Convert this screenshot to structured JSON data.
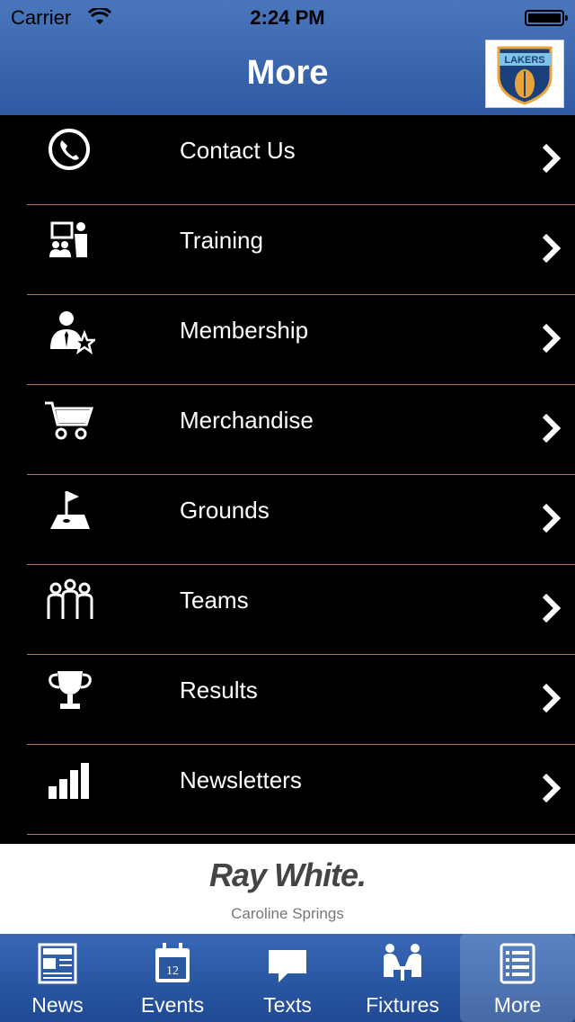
{
  "status_bar": {
    "carrier": "Carrier",
    "time": "2:24 PM"
  },
  "header": {
    "title": "More",
    "logo_text": "LAKERS"
  },
  "menu": {
    "items": [
      {
        "label": "Contact Us",
        "icon": "phone-icon"
      },
      {
        "label": "Training",
        "icon": "presentation-icon"
      },
      {
        "label": "Membership",
        "icon": "member-star-icon"
      },
      {
        "label": "Merchandise",
        "icon": "shopping-cart-icon"
      },
      {
        "label": "Grounds",
        "icon": "golf-flag-icon"
      },
      {
        "label": "Teams",
        "icon": "team-people-icon"
      },
      {
        "label": "Results",
        "icon": "trophy-icon"
      },
      {
        "label": "Newsletters",
        "icon": "bar-chart-icon"
      }
    ]
  },
  "sponsor": {
    "name": "Ray White.",
    "location": "Caroline Springs"
  },
  "tabbar": {
    "tabs": [
      {
        "label": "News",
        "icon": "newspaper-icon"
      },
      {
        "label": "Events",
        "icon": "calendar-icon",
        "calendar_day": "12"
      },
      {
        "label": "Texts",
        "icon": "speech-bubble-icon"
      },
      {
        "label": "Fixtures",
        "icon": "meeting-icon"
      },
      {
        "label": "More",
        "icon": "list-icon"
      }
    ],
    "active": "More"
  },
  "colors": {
    "header_blue": "#3a68b2",
    "separator": "#b07a4c",
    "tabbar_blue": "#2a589f"
  }
}
